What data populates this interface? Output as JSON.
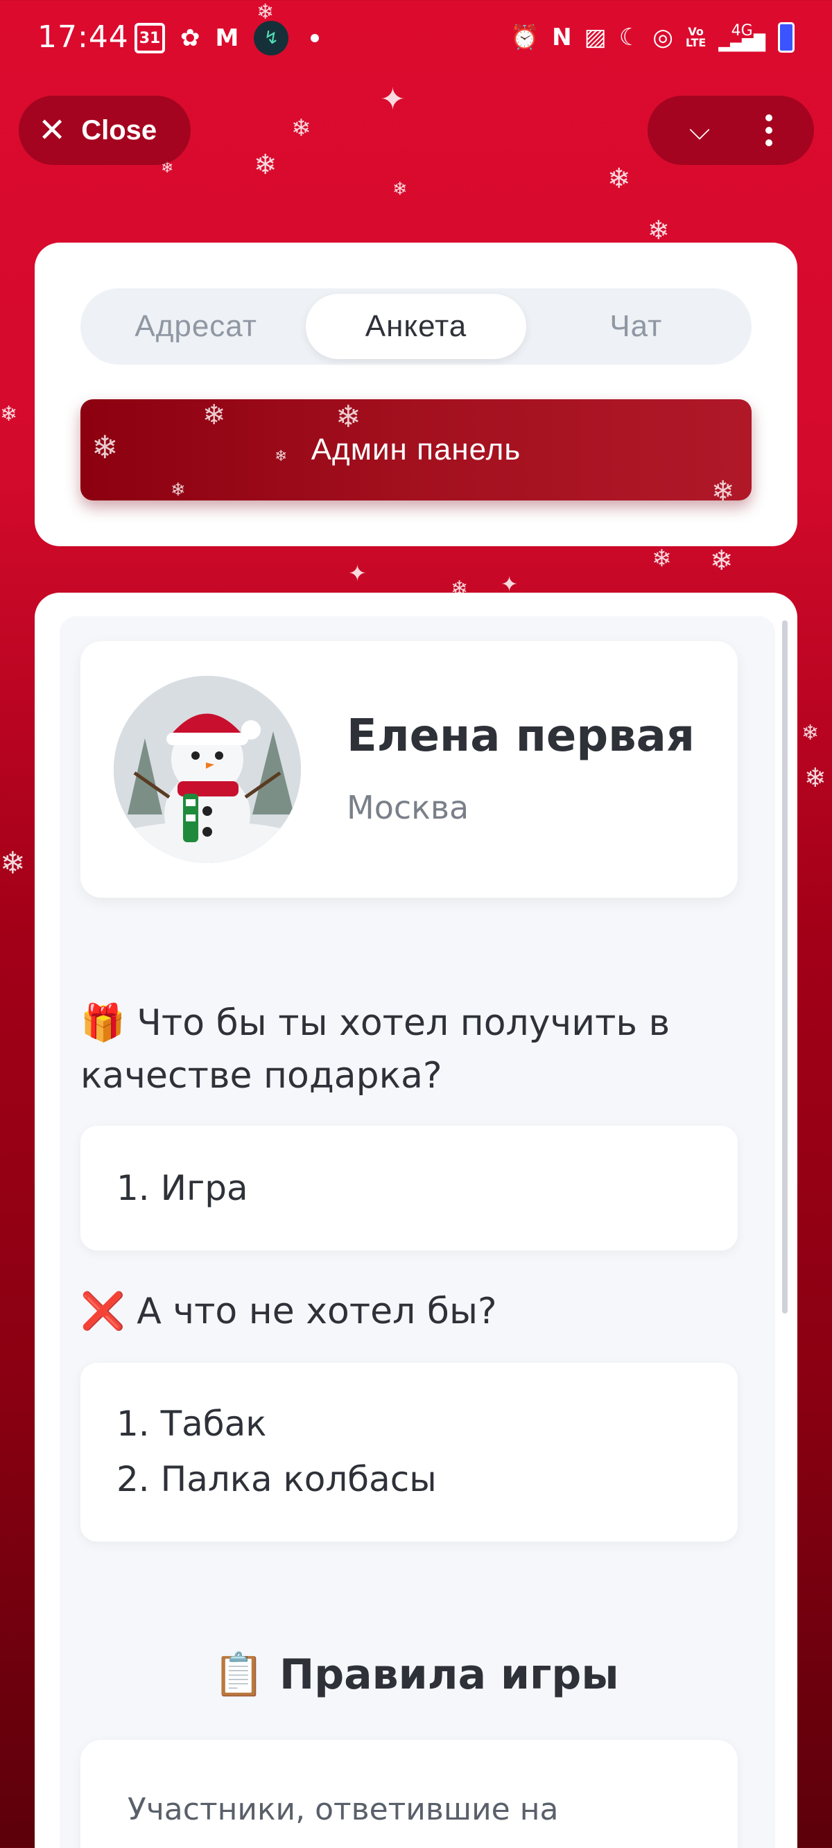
{
  "status_bar": {
    "time": "17:44",
    "calendar_day": "31",
    "left_icons": [
      "calendar-icon",
      "cast-app-icon",
      "gmail-icon",
      "app-icon",
      "notification-dot"
    ],
    "right_icons": [
      "alarm-icon",
      "nfc-icon",
      "cast-icon",
      "moon-icon",
      "hotspot-icon",
      "volte-icon",
      "signal-icon",
      "battery-icon"
    ],
    "volte": "Vo\nLTE",
    "network": "4G"
  },
  "top_bar": {
    "close_label": "Close"
  },
  "tabs": {
    "items": [
      "Адресат",
      "Анкета",
      "Чат"
    ],
    "active": "Анкета"
  },
  "admin_button": {
    "label": "Админ панель"
  },
  "profile": {
    "name": "Елена первая",
    "city": "Москва"
  },
  "questions": {
    "want": {
      "emoji": "🎁",
      "text": "Что бы ты хотел получить в качестве подарка?",
      "answers": [
        "1. Игра"
      ]
    },
    "not_want": {
      "emoji": "❌",
      "text": "А что не хотел бы?",
      "answers": [
        "1. Табак",
        "2. Палка колбасы"
      ]
    }
  },
  "rules": {
    "emoji": "📋",
    "title": "Правила игры",
    "text": "Участники, ответившие на"
  },
  "colors": {
    "background_top": "#dc0b2e",
    "background_bottom": "#5c000a",
    "admin_button": "#a3101e",
    "card": "#ffffff",
    "segment_bg": "#eef1f5",
    "text": "#2e3138"
  }
}
